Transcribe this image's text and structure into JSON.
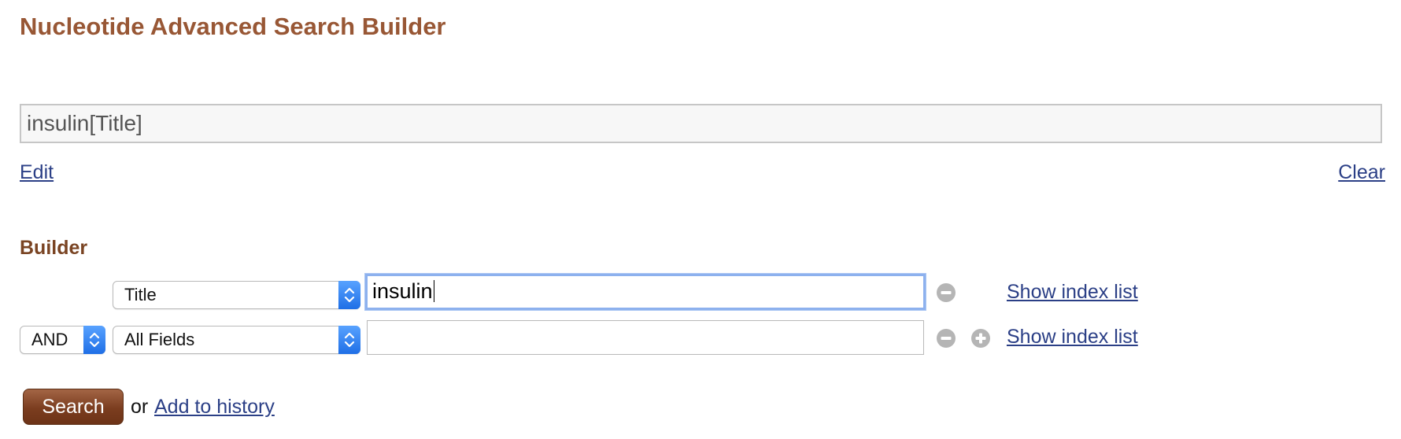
{
  "page": {
    "title": "Nucleotide Advanced Search Builder"
  },
  "query": {
    "value": "insulin[Title]",
    "edit_label": "Edit",
    "clear_label": "Clear"
  },
  "builder": {
    "heading": "Builder",
    "rows": [
      {
        "field": "Title",
        "term": "insulin",
        "remove_icon": "minus-circle-icon",
        "index_link": "Show index list"
      },
      {
        "operator": "AND",
        "field": "All Fields",
        "term": "",
        "remove_icon": "minus-circle-icon",
        "add_icon": "plus-circle-icon",
        "index_link": "Show index list"
      }
    ]
  },
  "actions": {
    "search_label": "Search",
    "or_text": "or",
    "history_link": "Add to history"
  },
  "colors": {
    "title": "#985735",
    "heading": "#7a4423",
    "link": "#2b3f86",
    "search_button": "#7b3d1f",
    "select_stepper": "#2f7ff0",
    "focus_ring": "#8db1ee"
  }
}
